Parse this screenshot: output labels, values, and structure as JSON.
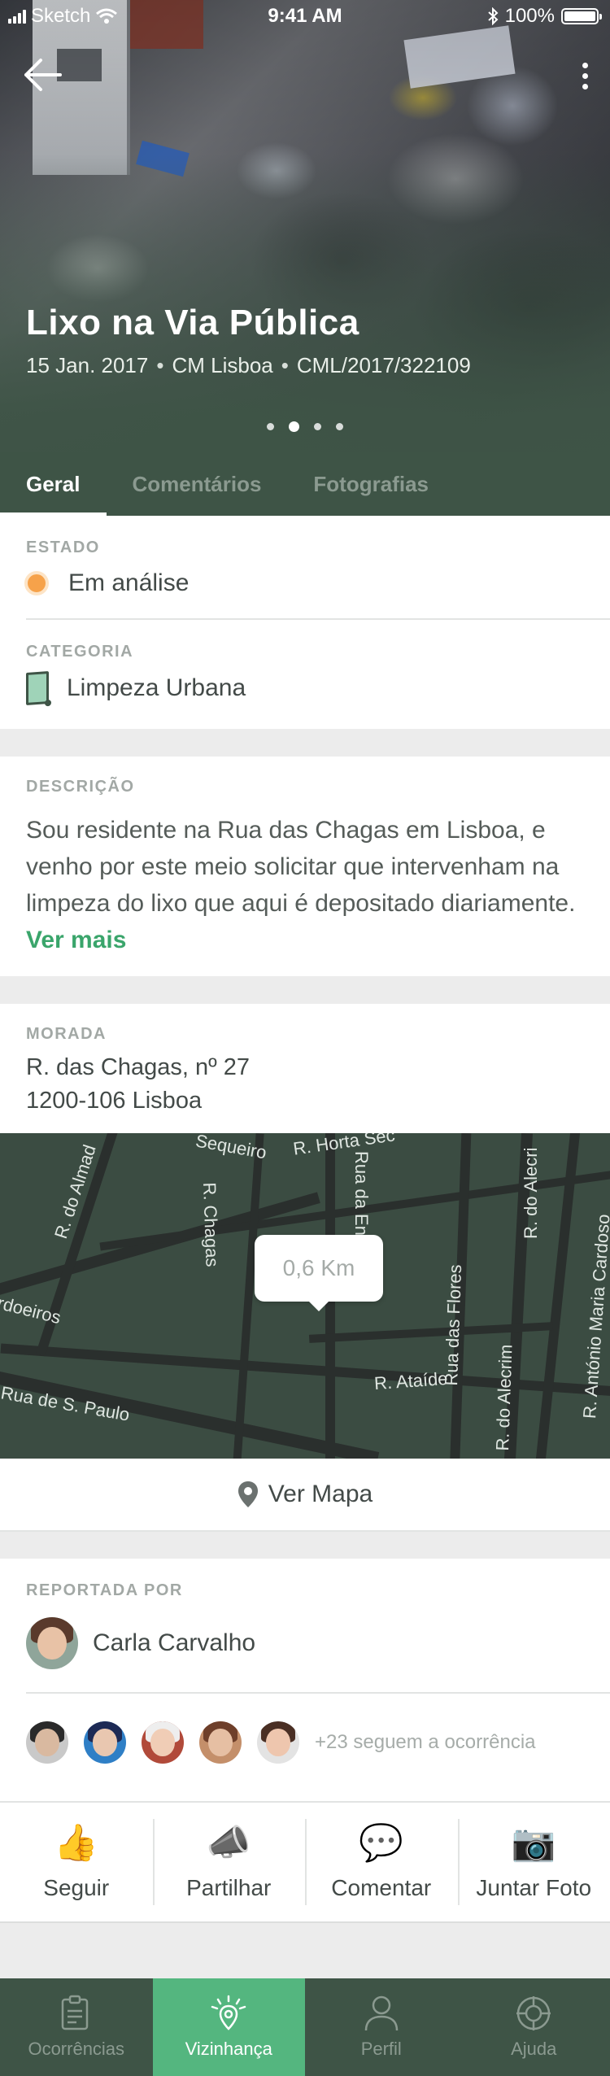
{
  "status_bar": {
    "carrier": "Sketch",
    "time": "9:41 AM",
    "battery": "100%"
  },
  "hero": {
    "title": "Lixo na Via Pública",
    "date": "15 Jan. 2017",
    "entity": "CM Lisboa",
    "reference": "CML/2017/322109",
    "separator": "•",
    "carousel_total": 4,
    "carousel_active": 2
  },
  "tabs": [
    {
      "label": "Geral",
      "active": true
    },
    {
      "label": "Comentários",
      "active": false
    },
    {
      "label": "Fotografias",
      "active": false
    }
  ],
  "estado": {
    "label": "ESTADO",
    "value": "Em análise",
    "color": "#f6a24a"
  },
  "categoria": {
    "label": "CATEGORIA",
    "value": "Limpeza Urbana"
  },
  "descricao": {
    "label": "DESCRIÇÃO",
    "text": "Sou residente na Rua das Chagas em Lisboa, e venho por este meio solicitar que intervenham na limpeza do lixo que aqui é depositado diariamente.",
    "more_link": "Ver mais"
  },
  "morada": {
    "label": "MORADA",
    "line1": "R. das Chagas, nº 27",
    "line2": "1200-106 Lisboa"
  },
  "map": {
    "distance": "0,6 Km",
    "streets": {
      "sequeiro": "Sequeiro",
      "horta_seca": "R. Horta Sec",
      "chagas": "R. Chagas",
      "rua_da_en": "Rua da En",
      "alecrim_top": "R. do Alecri",
      "almada": "R. do Almad",
      "cardoso": "R. António Maria Cardoso",
      "flores": "Rua das Flores",
      "ataide": "R. Ataíde",
      "alecrim": "R. do Alecrim",
      "roeiros": "rdoeiros",
      "sao_paulo": "Rua de S. Paulo"
    },
    "button_label": "Ver Mapa"
  },
  "reportada": {
    "label": "REPORTADA POR",
    "name": "Carla Carvalho",
    "followers_text": "+23 seguem a ocorrência"
  },
  "actions": [
    {
      "icon": "thumbs-up-icon",
      "glyph": "👍",
      "label": "Seguir"
    },
    {
      "icon": "megaphone-icon",
      "glyph": "📣",
      "label": "Partilhar"
    },
    {
      "icon": "speech-bubble-icon",
      "glyph": "💬",
      "label": "Comentar"
    },
    {
      "icon": "camera-icon",
      "glyph": "📷",
      "label": "Juntar Foto"
    }
  ],
  "tabbar": [
    {
      "icon": "clipboard-icon",
      "label": "Ocorrências",
      "active": false
    },
    {
      "icon": "location-pin-icon",
      "label": "Vizinhança",
      "active": true
    },
    {
      "icon": "person-icon",
      "label": "Perfil",
      "active": false
    },
    {
      "icon": "lifebuoy-icon",
      "label": "Ajuda",
      "active": false
    }
  ],
  "colors": {
    "primary": "#3e5446",
    "accent": "#54b67f",
    "link": "#3aa56b",
    "status_orange": "#f6a24a"
  }
}
